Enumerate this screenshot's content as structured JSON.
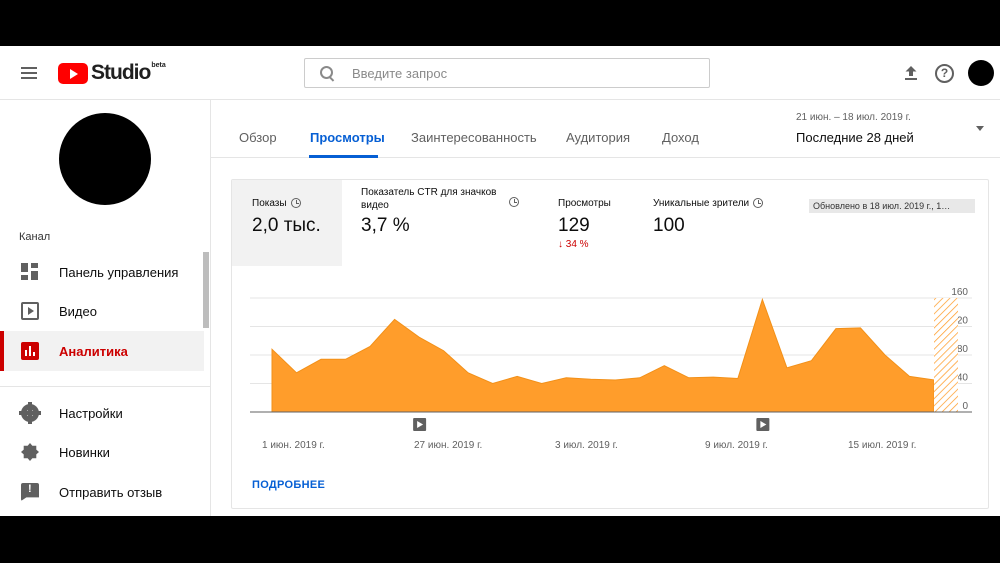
{
  "header": {
    "logo_text": "Studio",
    "logo_badge": "beta",
    "search_placeholder": "Введите запрос"
  },
  "sidebar": {
    "section_label": "Канал",
    "items": [
      {
        "label": "Панель управления",
        "icon": "dashboard-icon"
      },
      {
        "label": "Видео",
        "icon": "video-icon"
      },
      {
        "label": "Аналитика",
        "icon": "analytics-icon",
        "active": true
      },
      {
        "label": "Настройки",
        "icon": "gear-icon"
      },
      {
        "label": "Новинки",
        "icon": "whats-new-icon"
      },
      {
        "label": "Отправить отзыв",
        "icon": "feedback-icon"
      }
    ]
  },
  "tabs": [
    {
      "label": "Обзор"
    },
    {
      "label": "Просмотры",
      "active": true
    },
    {
      "label": "Заинтересованность"
    },
    {
      "label": "Аудитория"
    },
    {
      "label": "Доход"
    }
  ],
  "date_range": {
    "dates": "21 июн. – 18 июл. 2019 г.",
    "label": "Последние 28 дней"
  },
  "metrics": [
    {
      "title": "Показы",
      "value": "2,0 тыс.",
      "selected": true
    },
    {
      "title": "Показатель CTR для значков видео",
      "value": "3,7 %"
    },
    {
      "title": "Просмотры",
      "value": "129",
      "change": "34 %"
    },
    {
      "title": "Уникальные зрители",
      "value": "100"
    }
  ],
  "updated_text": "Обновлено в 18 июл. 2019 г., 1…",
  "more_link": "ПОДРОБНЕЕ",
  "colors": {
    "accent": "#065fd4",
    "active_nav": "#cc0000",
    "chart_fill": "#ff9d2b",
    "chart_line": "#f29018"
  },
  "chart_data": {
    "type": "area",
    "x": [
      "21 июн.",
      "22 июн.",
      "23 июн.",
      "24 июн.",
      "25 июн.",
      "26 июн.",
      "27 июн.",
      "28 июн.",
      "29 июн.",
      "30 июн.",
      "1 июл.",
      "2 июл.",
      "3 июл.",
      "4 июл.",
      "5 июл.",
      "6 июл.",
      "7 июл.",
      "8 июл.",
      "9 июл.",
      "10 июл.",
      "11 июл.",
      "12 июл.",
      "13 июл.",
      "14 июл.",
      "15 июл.",
      "16 июл.",
      "17 июл.",
      "18 июл."
    ],
    "values": [
      88,
      55,
      74,
      74,
      92,
      130,
      105,
      86,
      55,
      40,
      50,
      40,
      48,
      46,
      45,
      48,
      65,
      48,
      49,
      47,
      158,
      62,
      72,
      117,
      118,
      80,
      50,
      45
    ],
    "x_tick_labels": [
      "1 июн. 2019 г.",
      "27 июн. 2019 г.",
      "3 июл. 2019 г.",
      "9 июл. 2019 г.",
      "15 июл. 2019 г."
    ],
    "y_ticks": [
      "160",
      "120",
      "80",
      "40",
      "0"
    ],
    "ylim": [
      0,
      160
    ],
    "y_axis_position": "right",
    "grid": true,
    "incomplete_last_day": true,
    "video_markers_on": [
      "27 июн.",
      "11 июл."
    ]
  }
}
